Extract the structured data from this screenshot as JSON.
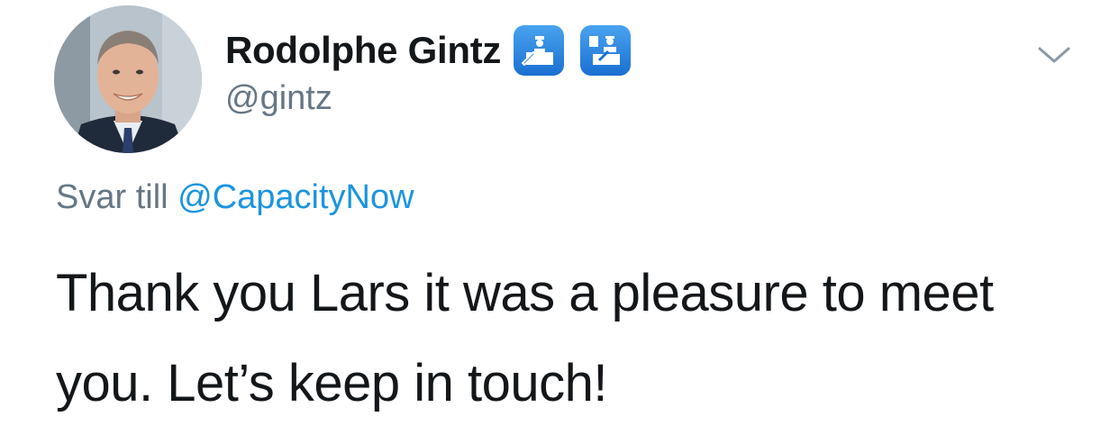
{
  "tweet": {
    "display_name": "Rodolphe Gintz",
    "handle": "@gintz",
    "emoji_icons": [
      "customs-emoji-icon",
      "passport-control-emoji-icon"
    ],
    "reply_prefix": "Svar till",
    "reply_handle": "@CapacityNow",
    "text": "Thank you Lars it was a pleasure to meet you. Let’s keep in touch!",
    "menu_icon": "chevron-down-icon"
  },
  "colors": {
    "name": "#14171a",
    "secondary": "#657786",
    "link": "#1b95e0",
    "badge": "#1a6fd1"
  }
}
